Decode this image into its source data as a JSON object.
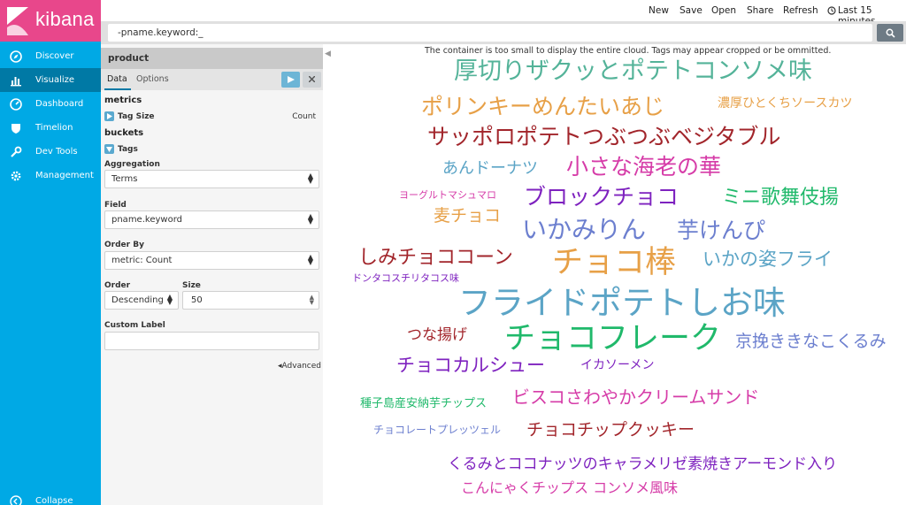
{
  "app": {
    "logo_text": "kibana"
  },
  "nav": {
    "items": [
      {
        "label": "Discover",
        "icon": "compass-icon"
      },
      {
        "label": "Visualize",
        "icon": "bar-chart-icon"
      },
      {
        "label": "Dashboard",
        "icon": "dashboard-icon"
      },
      {
        "label": "Timelion",
        "icon": "shield-icon"
      },
      {
        "label": "Dev Tools",
        "icon": "wrench-icon"
      },
      {
        "label": "Management",
        "icon": "gear-icon"
      }
    ],
    "collapse_label": "Collapse"
  },
  "topbar": {
    "new": "New",
    "save": "Save",
    "open": "Open",
    "share": "Share",
    "refresh": "Refresh",
    "time": "Last 15 minutes"
  },
  "search": {
    "value": "-pname.keyword:_"
  },
  "editor": {
    "title": "product",
    "tabs": [
      "Data",
      "Options"
    ],
    "metrics_heading": "metrics",
    "metric_label": "Tag Size",
    "metric_value": "Count",
    "buckets_heading": "buckets",
    "bucket_label": "Tags",
    "aggregation_label": "Aggregation",
    "aggregation_value": "Terms",
    "field_label": "Field",
    "field_value": "pname.keyword",
    "order_by_label": "Order By",
    "order_by_value": "metric: Count",
    "order_label": "Order",
    "order_value": "Descending",
    "size_label": "Size",
    "size_value": "50",
    "custom_label_label": "Custom Label",
    "custom_label_value": "",
    "advanced": "Advanced"
  },
  "cloud": {
    "warning": "The container is too small to display the entire cloud. Tags may appear cropped or be ommitted.",
    "tags": [
      {
        "text": "厚切りザクッとポテトコンソメ味",
        "color": "#54B399"
      },
      {
        "text": "ポリンキーめんたいあじ",
        "color": "#E7A047"
      },
      {
        "text": "濃厚ひとくちソースカツ",
        "color": "#E7A047"
      },
      {
        "text": "サッポロポテトつぶつぶベジタブル",
        "color": "#A2252B"
      },
      {
        "text": "あんドーナツ",
        "color": "#5BA4C6"
      },
      {
        "text": "小さな海老の華",
        "color": "#D63CA8"
      },
      {
        "text": "ヨーグルトマシュマロ",
        "color": "#D63CA8"
      },
      {
        "text": "ブロックチョコ",
        "color": "#7E22BF"
      },
      {
        "text": "ミニ歌舞伎揚",
        "color": "#20B96B"
      },
      {
        "text": "麦チョコ",
        "color": "#E7A047"
      },
      {
        "text": "いかみりん",
        "color": "#6C7FCF"
      },
      {
        "text": "芋けんぴ",
        "color": "#6C7FCF"
      },
      {
        "text": "しみチョココーン",
        "color": "#A2252B"
      },
      {
        "text": "チョコ棒",
        "color": "#E7A047"
      },
      {
        "text": "いかの姿フライ",
        "color": "#5BA4C6"
      },
      {
        "text": "ドンタコスチリタコス味",
        "color": "#7E22BF"
      },
      {
        "text": "フライドポテトしお味",
        "color": "#5BA4C6"
      },
      {
        "text": "つな揚げ",
        "color": "#A2252B"
      },
      {
        "text": "チョコフレーク",
        "color": "#20B96B"
      },
      {
        "text": "京挽ききなこくるみ",
        "color": "#6C7FCF"
      },
      {
        "text": "チョコカルシュー",
        "color": "#7E22BF"
      },
      {
        "text": "イカソーメン",
        "color": "#7E22BF"
      },
      {
        "text": "種子島産安納芋チップス",
        "color": "#20B96B"
      },
      {
        "text": "ビスコさわやかクリームサンド",
        "color": "#D63CA8"
      },
      {
        "text": "チョコレートプレッツェル",
        "color": "#6C7FCF"
      },
      {
        "text": "チョコチップクッキー",
        "color": "#A2252B"
      },
      {
        "text": "くるみとココナッツのキャラメリゼ素焼きアーモンド入り",
        "color": "#7E22BF"
      },
      {
        "text": "こんにゃくチップス コンソメ風味",
        "color": "#D63CA8"
      }
    ]
  }
}
